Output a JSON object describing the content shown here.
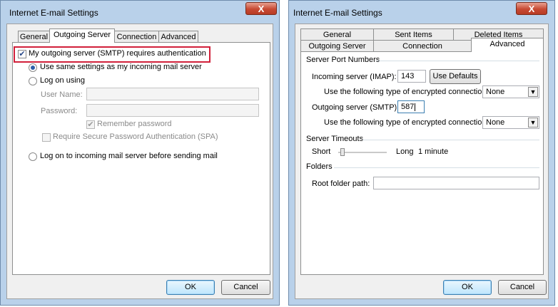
{
  "left_dialog": {
    "title": "Internet E-mail Settings",
    "close_label": "X",
    "tabs": [
      "General",
      "Outgoing Server",
      "Connection",
      "Advanced"
    ],
    "active_tab": "Outgoing Server",
    "smtp_auth_label": "My outgoing server (SMTP) requires authentication",
    "smtp_auth_checked": true,
    "radio_same_settings": "Use same settings as my incoming mail server",
    "radio_log_on_using": "Log on using",
    "user_name_label": "User Name:",
    "user_name_value": "",
    "password_label": "Password:",
    "password_value": "",
    "remember_password_label": "Remember password",
    "remember_password_checked": true,
    "spa_label": "Require Secure Password Authentication (SPA)",
    "spa_checked": false,
    "radio_log_on_incoming": "Log on to incoming mail server before sending mail",
    "selected_radio": "same_settings",
    "ok_label": "OK",
    "cancel_label": "Cancel",
    "highlight_color": "#d1203a"
  },
  "right_dialog": {
    "title": "Internet E-mail Settings",
    "close_label": "X",
    "tabs_row1": [
      "General",
      "Sent Items",
      "Deleted Items"
    ],
    "tabs_row2": [
      "Outgoing Server",
      "Connection",
      "Advanced"
    ],
    "active_tab": "Advanced",
    "server_port_numbers_label": "Server Port Numbers",
    "incoming_label": "Incoming server (IMAP):",
    "incoming_port": "143",
    "use_defaults_label": "Use Defaults",
    "encrypt_label_incoming": "Use the following type of encrypted connection:",
    "encrypt_value_incoming": "None",
    "outgoing_label": "Outgoing server (SMTP):",
    "outgoing_port": "587",
    "encrypt_label_outgoing": "Use the following type of encrypted connection:",
    "encrypt_value_outgoing": "None",
    "server_timeouts_label": "Server Timeouts",
    "timeout_short": "Short",
    "timeout_long": "Long",
    "timeout_value": "1 minute",
    "timeout_level": 0.05,
    "folders_label": "Folders",
    "root_folder_label": "Root folder path:",
    "root_folder_value": "",
    "ok_label": "OK",
    "cancel_label": "Cancel"
  }
}
